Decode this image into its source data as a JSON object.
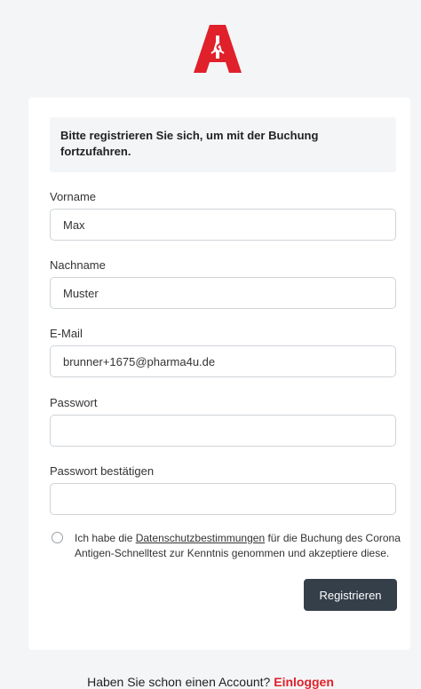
{
  "notice": "Bitte registrieren Sie sich, um mit der Buchung fortzufahren.",
  "fields": {
    "firstname": {
      "label": "Vorname",
      "value": "Max"
    },
    "lastname": {
      "label": "Nachname",
      "value": "Muster"
    },
    "email": {
      "label": "E-Mail",
      "value": "brunner+1675@pharma4u.de"
    },
    "password": {
      "label": "Passwort",
      "value": ""
    },
    "password_confirm": {
      "label": "Passwort bestätigen",
      "value": ""
    }
  },
  "consent": {
    "before": "Ich habe die ",
    "link": "Datenschutzbestimmungen",
    "after": " für die Buchung des Corona Antigen-Schnelltest zur Kenntnis genommen und akzeptiere diese."
  },
  "submit_label": "Registrieren",
  "footer": {
    "question": "Haben Sie schon einen Account? ",
    "login_link": "Einloggen"
  },
  "colors": {
    "logo_red": "#e0202a",
    "button_bg": "#353f4a",
    "link_red": "#e0202a"
  },
  "icons": {
    "logo": "apotheke-a-logo-icon"
  }
}
